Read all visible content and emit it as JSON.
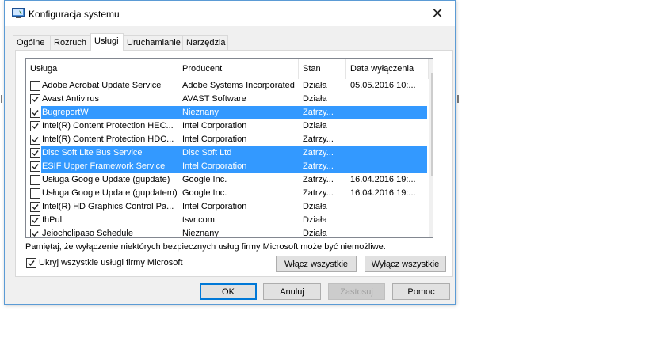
{
  "window": {
    "title": "Konfiguracja systemu",
    "close_glyph": "✕",
    "icon": "system-config-icon"
  },
  "tabs": [
    {
      "label": "Ogólne",
      "active": false
    },
    {
      "label": "Rozruch",
      "active": false
    },
    {
      "label": "Usługi",
      "active": true
    },
    {
      "label": "Uruchamianie",
      "active": false
    },
    {
      "label": "Narzędzia",
      "active": false
    }
  ],
  "services": {
    "columns": [
      "Usługa",
      "Producent",
      "Stan",
      "Data wyłączenia"
    ],
    "rows": [
      {
        "name": "Adobe Acrobat Update Service",
        "vendor": "Adobe Systems Incorporated",
        "status": "Działa",
        "date": "05.05.2016 10:...",
        "checked": false,
        "selected": false
      },
      {
        "name": "Avast Antivirus",
        "vendor": "AVAST Software",
        "status": "Działa",
        "date": "",
        "checked": true,
        "selected": false
      },
      {
        "name": "BugreportW",
        "vendor": "Nieznany",
        "status": "Zatrzy...",
        "date": "",
        "checked": true,
        "selected": true
      },
      {
        "name": "Intel(R) Content Protection HEC...",
        "vendor": "Intel Corporation",
        "status": "Działa",
        "date": "",
        "checked": true,
        "selected": false
      },
      {
        "name": "Intel(R) Content Protection HDC...",
        "vendor": "Intel Corporation",
        "status": "Zatrzy...",
        "date": "",
        "checked": true,
        "selected": false
      },
      {
        "name": "Disc Soft Lite Bus Service",
        "vendor": "Disc Soft Ltd",
        "status": "Zatrzy...",
        "date": "",
        "checked": true,
        "selected": true
      },
      {
        "name": "ESIF Upper Framework Service",
        "vendor": "Intel Corporation",
        "status": "Zatrzy...",
        "date": "",
        "checked": true,
        "selected": true
      },
      {
        "name": "Usługa Google Update (gupdate)",
        "vendor": "Google Inc.",
        "status": "Zatrzy...",
        "date": "16.04.2016 19:...",
        "checked": false,
        "selected": false
      },
      {
        "name": "Usługa Google Update (gupdatem)",
        "vendor": "Google Inc.",
        "status": "Zatrzy...",
        "date": "16.04.2016 19:...",
        "checked": false,
        "selected": false
      },
      {
        "name": "Intel(R) HD Graphics Control Pa...",
        "vendor": "Intel Corporation",
        "status": "Działa",
        "date": "",
        "checked": true,
        "selected": false
      },
      {
        "name": "IhPul",
        "vendor": "tsvr.com",
        "status": "Działa",
        "date": "",
        "checked": true,
        "selected": false
      },
      {
        "name": "Jeiochclipaso Schedule",
        "vendor": "Nieznany",
        "status": "Działa",
        "date": "",
        "checked": true,
        "selected": false
      }
    ]
  },
  "note": "Pamiętaj, że wyłączenie niektórych bezpiecznych usług firmy Microsoft może być niemożliwe.",
  "hide_microsoft": {
    "label": "Ukryj wszystkie usługi firmy Microsoft",
    "checked": true
  },
  "buttons": {
    "enable_all": "Włącz wszystkie",
    "disable_all": "Wyłącz wszystkie",
    "ok": "OK",
    "cancel": "Anuluj",
    "apply": "Zastosuj",
    "help": "Pomoc"
  },
  "colors": {
    "selection": "#3399ff",
    "dialog_bg": "#f0f0f0",
    "border_accent": "#0078d7"
  }
}
